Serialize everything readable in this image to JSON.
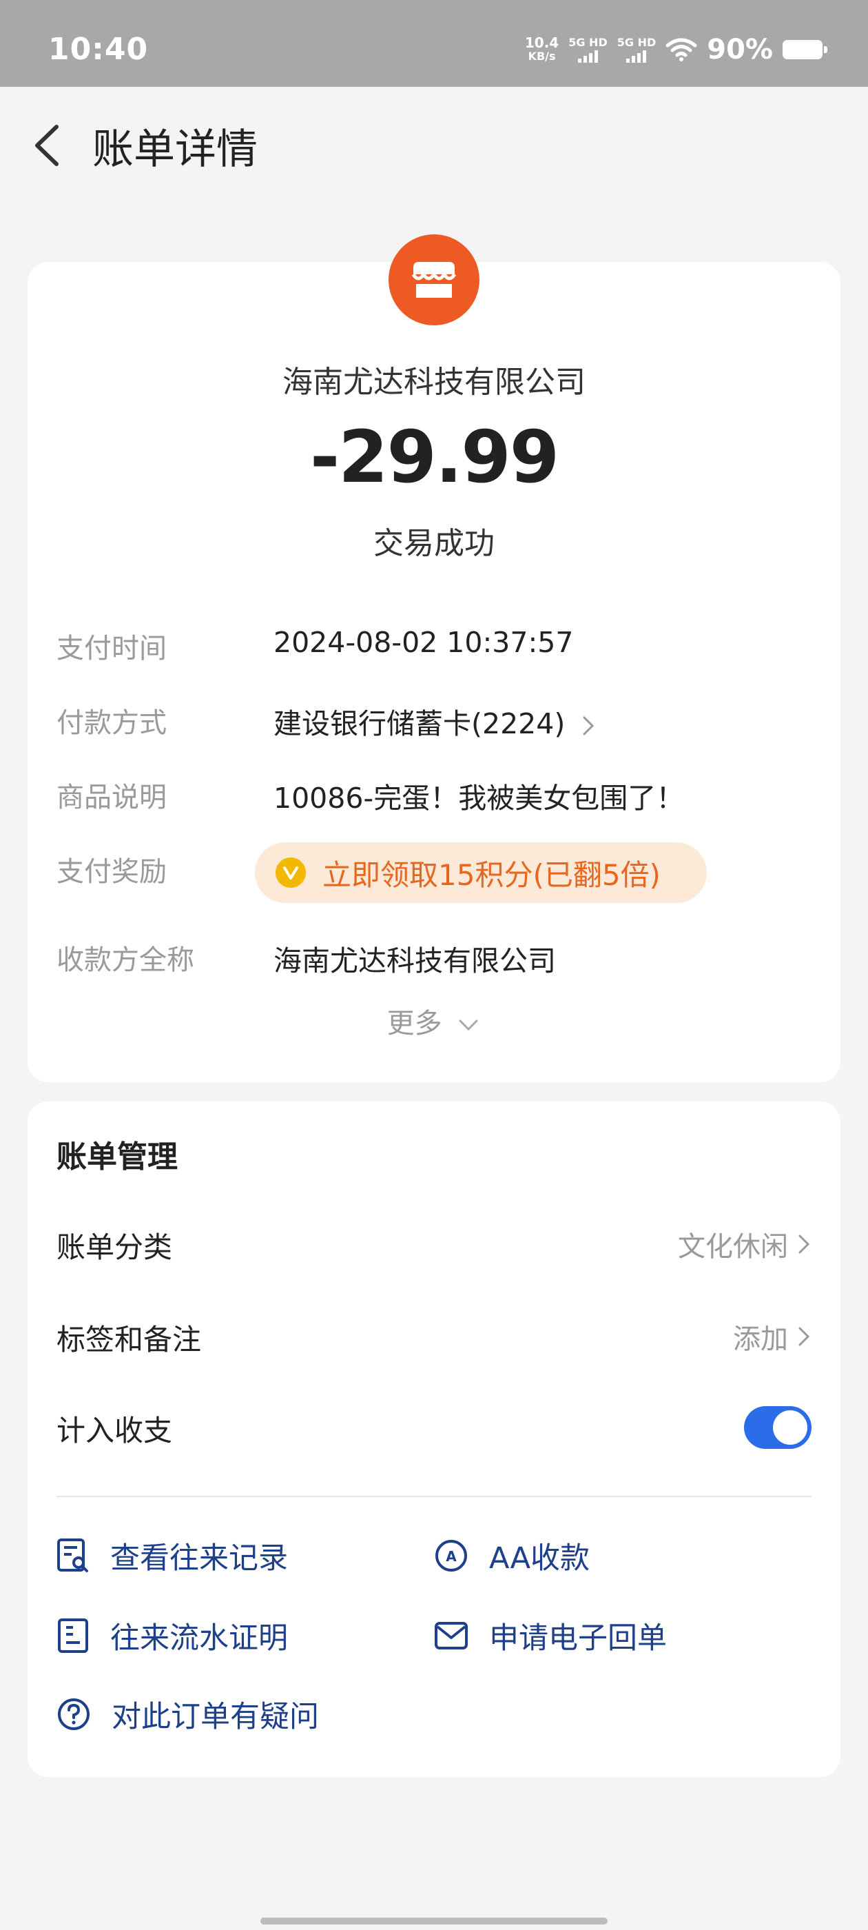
{
  "status_bar": {
    "time": "10:40",
    "net_speed_value": "10.4",
    "net_speed_unit": "KB/s",
    "sim1": "5G HD",
    "sim2": "5G HD",
    "battery": "90%",
    "icons": [
      "signal-icon",
      "wifi-icon",
      "battery-icon"
    ]
  },
  "header": {
    "title": "账单详情",
    "back_icon": "chevron-left-icon"
  },
  "summary": {
    "merchant_icon": "store-icon",
    "merchant_name": "海南尤达科技有限公司",
    "amount": "-29.99",
    "status": "交易成功",
    "accent_color": "#ee5a24"
  },
  "details": [
    {
      "label": "支付时间",
      "value": "2024-08-02 10:37:57"
    },
    {
      "label": "付款方式",
      "value": "建设银行储蓄卡(2224)"
    },
    {
      "label": "商品说明",
      "value": "10086-完蛋！我被美女包围了！"
    },
    {
      "label": "支付奖励",
      "value": "立即领取15积分(已翻5倍)"
    },
    {
      "label": "收款方全称",
      "value": "海南尤达科技有限公司"
    }
  ],
  "more_label": "更多",
  "management": {
    "title": "账单管理",
    "category_label": "账单分类",
    "category_value": "文化休闲",
    "tags_label": "标签和备注",
    "tags_value": "添加",
    "include_label": "计入收支",
    "include_on": true,
    "toggle_color": "#2b6ce8"
  },
  "actions": [
    {
      "label": "查看往来记录",
      "icon": "record-search-icon"
    },
    {
      "label": "AA收款",
      "icon": "aa-icon"
    },
    {
      "label": "往来流水证明",
      "icon": "statement-icon"
    },
    {
      "label": "申请电子回单",
      "icon": "mail-icon"
    },
    {
      "label": "对此订单有疑问",
      "icon": "question-icon"
    }
  ]
}
